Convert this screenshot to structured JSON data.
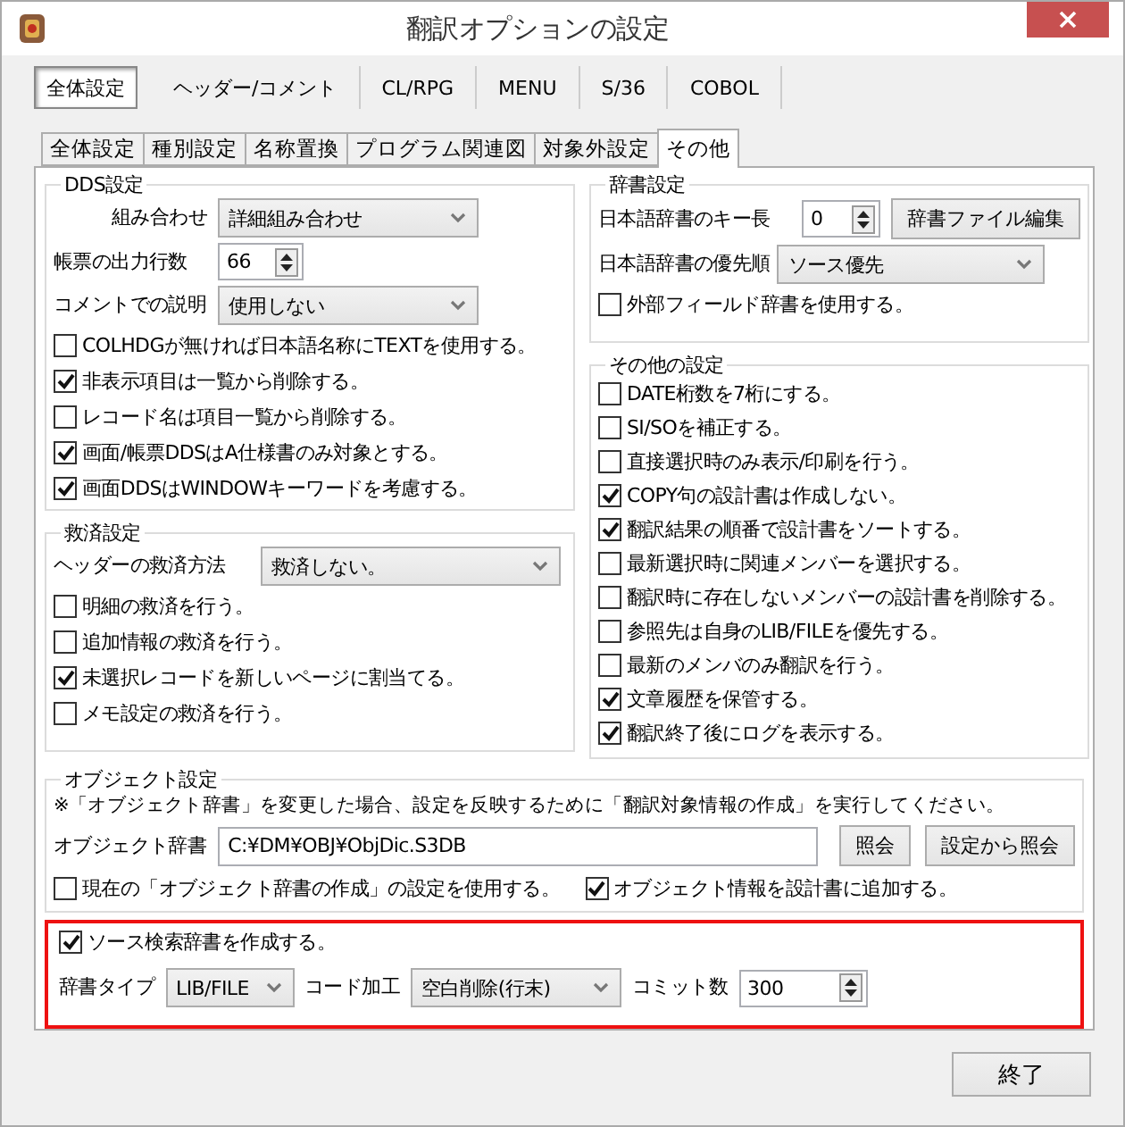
{
  "window": {
    "title": "翻訳オプションの設定"
  },
  "top_tabs": [
    {
      "label": "全体設定",
      "selected": true
    },
    {
      "label": "ヘッダー/コメント",
      "selected": false
    },
    {
      "label": "CL/RPG",
      "selected": false
    },
    {
      "label": "MENU",
      "selected": false
    },
    {
      "label": "S/36",
      "selected": false
    },
    {
      "label": "COBOL",
      "selected": false
    }
  ],
  "sub_tabs": [
    {
      "label": "全体設定",
      "selected": false
    },
    {
      "label": "種別設定",
      "selected": false
    },
    {
      "label": "名称置換",
      "selected": false
    },
    {
      "label": "プログラム関連図",
      "selected": false
    },
    {
      "label": "対象外設定",
      "selected": false
    },
    {
      "label": "その他",
      "selected": true
    }
  ],
  "dds": {
    "title": "DDS設定",
    "combine": {
      "label": "組み合わせ",
      "value": "詳細組み合わせ"
    },
    "lines": {
      "label": "帳票の出力行数",
      "value": "66"
    },
    "comment": {
      "label": "コメントでの説明",
      "value": "使用しない"
    },
    "checks": [
      {
        "label": "COLHDGが無ければ日本語名称にTEXTを使用する。",
        "checked": false
      },
      {
        "label": "非表示項目は一覧から削除する。",
        "checked": true
      },
      {
        "label": "レコード名は項目一覧から削除する。",
        "checked": false
      },
      {
        "label": "画面/帳票DDSはA仕様書のみ対象とする。",
        "checked": true
      },
      {
        "label": "画面DDSはWINDOWキーワードを考慮する。",
        "checked": true
      }
    ]
  },
  "relief": {
    "title": "救済設定",
    "header_method": {
      "label": "ヘッダーの救済方法",
      "value": "救済しない。"
    },
    "checks": [
      {
        "label": "明細の救済を行う。",
        "checked": false
      },
      {
        "label": "追加情報の救済を行う。",
        "checked": false
      },
      {
        "label": "未選択レコードを新しいページに割当てる。",
        "checked": true
      },
      {
        "label": "メモ設定の救済を行う。",
        "checked": false
      }
    ]
  },
  "dictionary": {
    "title": "辞書設定",
    "key_length": {
      "label": "日本語辞書のキー長",
      "value": "0"
    },
    "edit_button": "辞書ファイル編集",
    "priority": {
      "label": "日本語辞書の優先順",
      "value": "ソース優先"
    },
    "checks": [
      {
        "label": "外部フィールド辞書を使用する。",
        "checked": false
      }
    ]
  },
  "other": {
    "title": "その他の設定",
    "checks": [
      {
        "label": "DATE桁数を7桁にする。",
        "checked": false
      },
      {
        "label": "SI/SOを補正する。",
        "checked": false
      },
      {
        "label": "直接選択時のみ表示/印刷を行う。",
        "checked": false
      },
      {
        "label": "COPY句の設計書は作成しない。",
        "checked": true
      },
      {
        "label": "翻訳結果の順番で設計書をソートする。",
        "checked": true
      },
      {
        "label": "最新選択時に関連メンバーを選択する。",
        "checked": false
      },
      {
        "label": "翻訳時に存在しないメンバーの設計書を削除する。",
        "checked": false
      },
      {
        "label": "参照先は自身のLIB/FILEを優先する。",
        "checked": false
      },
      {
        "label": "最新のメンバのみ翻訳を行う。",
        "checked": false
      },
      {
        "label": "文章履歴を保管する。",
        "checked": true
      },
      {
        "label": "翻訳終了後にログを表示する。",
        "checked": true
      }
    ]
  },
  "object": {
    "title": "オブジェクト設定",
    "note": "※「オブジェクト辞書」を変更した場合、設定を反映するために「翻訳対象情報の作成」を実行してください。",
    "dictionary": {
      "label": "オブジェクト辞書",
      "value": "C:¥DM¥OBJ¥ObjDic.S3DB"
    },
    "buttons": [
      "照会",
      "設定から照会"
    ],
    "checks": [
      {
        "label": "現在の「オブジェクト辞書の作成」の設定を使用する。",
        "checked": false
      },
      {
        "label": "オブジェクト情報を設計書に追加する。",
        "checked": true
      }
    ]
  },
  "source_dict": {
    "highlighted": true,
    "check": {
      "label": "ソース検索辞書を作成する。",
      "checked": true
    },
    "type": {
      "label": "辞書タイプ",
      "value": "LIB/FILE"
    },
    "code": {
      "label": "コード加工",
      "value": "空白削除(行末)"
    },
    "commit": {
      "label": "コミット数",
      "value": "300"
    }
  },
  "close_button": "終了"
}
